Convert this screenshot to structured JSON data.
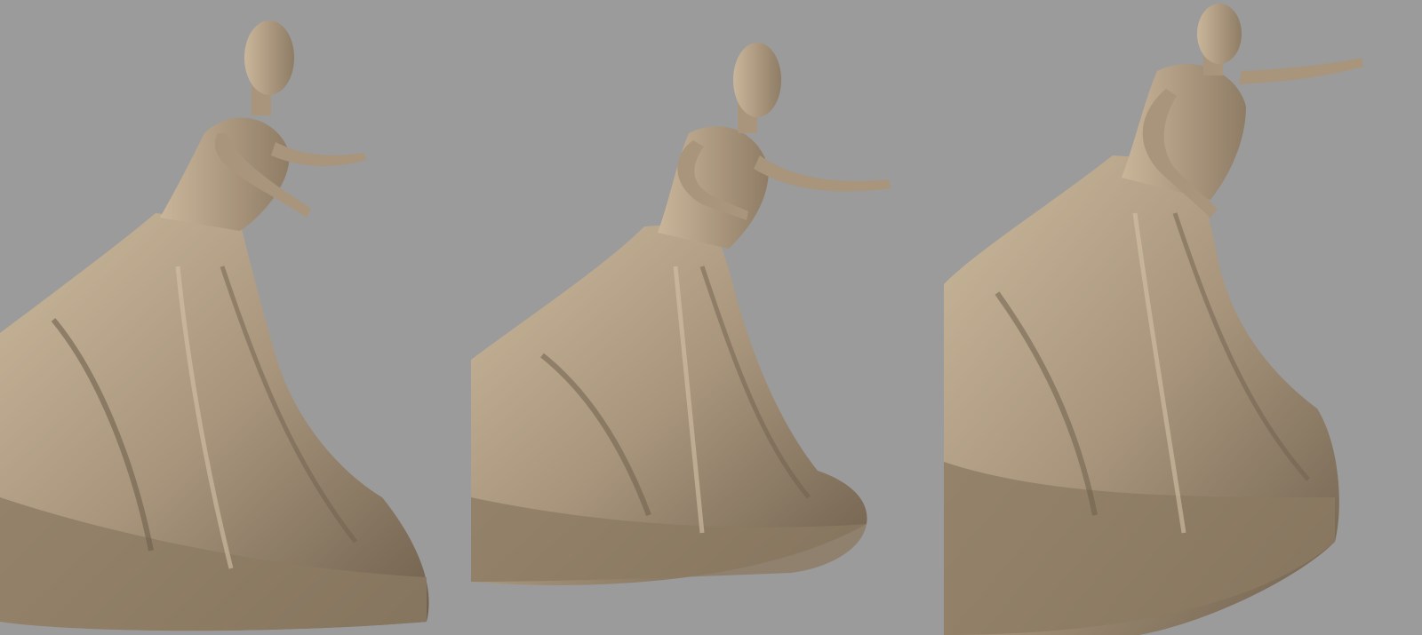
{
  "scene": {
    "background_color": "#9b9b9b",
    "model_color": "#a8957c",
    "model_shadow_color": "#6f604d",
    "model_highlight_color": "#d4c2a6",
    "views": [
      {
        "id": "front-three-quarter"
      },
      {
        "id": "front"
      },
      {
        "id": "side-three-quarter"
      }
    ]
  }
}
